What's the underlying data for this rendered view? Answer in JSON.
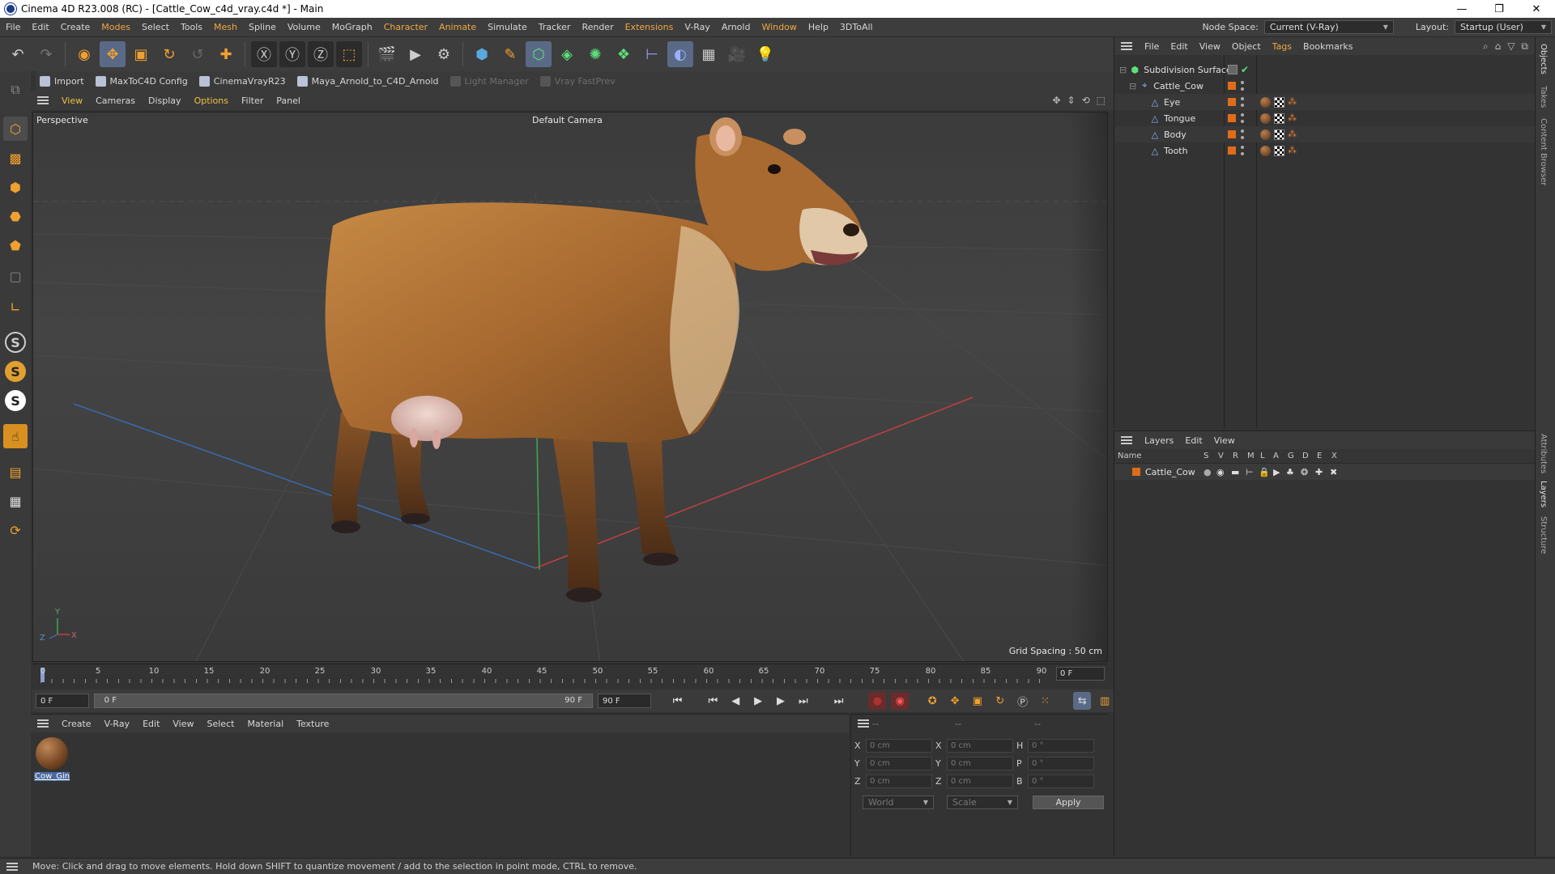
{
  "window": {
    "title": "Cinema 4D R23.008 (RC) - [Cattle_Cow_c4d_vray.c4d *] - Main",
    "controls": [
      "—",
      "❐",
      "✕"
    ]
  },
  "menubar": {
    "items": [
      "File",
      "Edit",
      "Create",
      "Modes",
      "Select",
      "Tools",
      "Mesh",
      "Spline",
      "Volume",
      "MoGraph",
      "Character",
      "Animate",
      "Simulate",
      "Tracker",
      "Render",
      "Extensions",
      "V-Ray",
      "Arnold",
      "Window",
      "Help",
      "3DToAll"
    ],
    "node_space_label": "Node Space:",
    "node_space_value": "Current (V-Ray)",
    "layout_label": "Layout:",
    "layout_value": "Startup (User)"
  },
  "plugin_bar": {
    "items": [
      {
        "label": "Import",
        "enabled": true
      },
      {
        "label": "MaxToC4D Config",
        "enabled": true
      },
      {
        "label": "CinemaVrayR23",
        "enabled": true
      },
      {
        "label": "Maya_Arnold_to_C4D_Arnold",
        "enabled": true
      },
      {
        "label": "Light Manager",
        "enabled": false
      },
      {
        "label": "Vray FastPrev",
        "enabled": false
      }
    ]
  },
  "viewport": {
    "menu": [
      "View",
      "Cameras",
      "Display",
      "Options",
      "Filter",
      "Panel"
    ],
    "view_name": "Perspective",
    "camera_name": "Default Camera",
    "grid_spacing": "Grid Spacing : 50 cm",
    "axis_labels": {
      "x": "X",
      "y": "Y",
      "z": "Z"
    }
  },
  "timeline": {
    "ticks": [
      "0",
      "5",
      "10",
      "15",
      "20",
      "25",
      "30",
      "35",
      "40",
      "45",
      "50",
      "55",
      "60",
      "65",
      "70",
      "75",
      "80",
      "85",
      "90"
    ],
    "current_frame_field": "0 F",
    "start_field": "0 F",
    "range_start": "0 F",
    "range_end": "90 F",
    "end_field": "90 F"
  },
  "material_manager": {
    "menu": [
      "Create",
      "V-Ray",
      "Edit",
      "View",
      "Select",
      "Material",
      "Texture"
    ],
    "materials": [
      {
        "name": "Cow_Gin"
      }
    ]
  },
  "coordinates": {
    "headers": [
      "--",
      "--",
      "--"
    ],
    "rows": [
      {
        "a": "X",
        "av": "0 cm",
        "b": "X",
        "bv": "0 cm",
        "c": "H",
        "cv": "0 °"
      },
      {
        "a": "Y",
        "av": "0 cm",
        "b": "Y",
        "bv": "0 cm",
        "c": "P",
        "cv": "0 °"
      },
      {
        "a": "Z",
        "av": "0 cm",
        "b": "Z",
        "bv": "0 cm",
        "c": "B",
        "cv": "0 °"
      }
    ],
    "space": "World",
    "mode": "Scale",
    "apply_label": "Apply"
  },
  "object_manager": {
    "menu": [
      "File",
      "Edit",
      "View",
      "Object",
      "Tags",
      "Bookmarks"
    ],
    "objects": [
      {
        "name": "Subdivision Surface"
      },
      {
        "name": "Cattle_Cow"
      },
      {
        "name": "Eye"
      },
      {
        "name": "Tongue"
      },
      {
        "name": "Body"
      },
      {
        "name": "Tooth"
      }
    ]
  },
  "layer_manager": {
    "menu": [
      "Layers",
      "Edit",
      "View"
    ],
    "columns": [
      "Name",
      "S",
      "V",
      "R",
      "M",
      "L",
      "A",
      "G",
      "D",
      "E",
      "X"
    ],
    "layers": [
      {
        "name": "Cattle_Cow",
        "color": "#e06c1a"
      }
    ]
  },
  "right_tabs": [
    "Objects",
    "Takes",
    "Content Browser",
    "Attributes",
    "Layers",
    "Structure"
  ],
  "status": {
    "message": "Move: Click and drag to move elements. Hold down SHIFT to quantize movement / add to the selection in point mode, CTRL to remove."
  },
  "colors": {
    "accent_orange": "#e06c1a",
    "menu_highlight": "#f0a840",
    "selection_blue": "#4a6aa0"
  }
}
